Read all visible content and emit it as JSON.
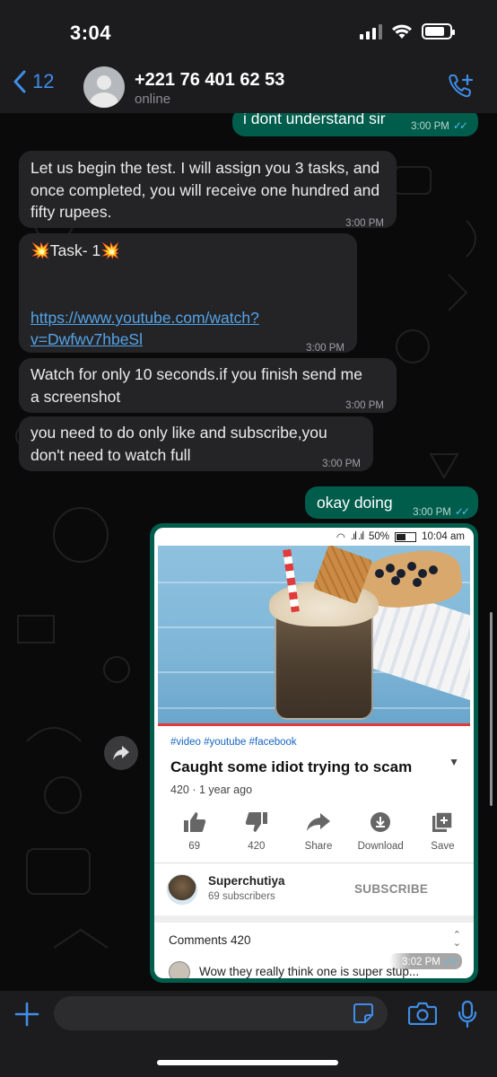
{
  "status_bar": {
    "time": "3:04"
  },
  "header": {
    "back_count": "12",
    "contact_name": "+221 76 401 62 53",
    "contact_status": "online"
  },
  "messages": [
    {
      "direction": "out",
      "text": "i dont understand sir",
      "time": "3:00 PM",
      "read": true
    },
    {
      "direction": "in",
      "text": "Let us begin the test. I will assign you 3 tasks, and once completed, you will receive one hundred and fifty rupees.",
      "time": "3:00 PM"
    },
    {
      "direction": "in",
      "title": "💥Task- 1💥",
      "link": "https://www.youtube.com/watch?v=Dwfwv7hbeSl",
      "link_line1": "https://www.youtube.com/watch?",
      "link_line2": "v=Dwfwv7hbeSl",
      "time": "3:00 PM"
    },
    {
      "direction": "in",
      "text": "Watch for only 10 seconds.if you finish send me a screenshot",
      "time": "3:00 PM"
    },
    {
      "direction": "in",
      "text": "you need to do only like and subscribe,you don't need to watch full",
      "time": "3:00 PM"
    },
    {
      "direction": "out",
      "text": "okay doing",
      "time": "3:00 PM",
      "read": true
    },
    {
      "direction": "out",
      "type": "image",
      "time": "3:02 PM",
      "read": true
    }
  ],
  "screenshot": {
    "status": {
      "battery": "50%",
      "time": "10:04 am"
    },
    "tags": "#video #youtube #facebook",
    "title": "Caught some idiot trying to scam",
    "meta": "420  · 1 year ago",
    "actions": [
      {
        "icon": "thumbs-up-icon",
        "label": "69"
      },
      {
        "icon": "thumbs-down-icon",
        "label": "420"
      },
      {
        "icon": "share-icon",
        "label": "Share"
      },
      {
        "icon": "download-icon",
        "label": "Download"
      },
      {
        "icon": "save-icon",
        "label": "Save"
      }
    ],
    "channel": {
      "name": "Superchutiya",
      "subscribers": "69 subscribers",
      "subscribe_label": "SUBSCRIBE"
    },
    "comments_label": "Comments 420",
    "first_comment": "Wow they really think one is super stup..."
  },
  "composer": {
    "placeholder": ""
  },
  "colors": {
    "accent": "#3f8ee8",
    "outgoing": "#005c4b",
    "incoming": "#242426",
    "read_ticks": "#53bdeb"
  }
}
